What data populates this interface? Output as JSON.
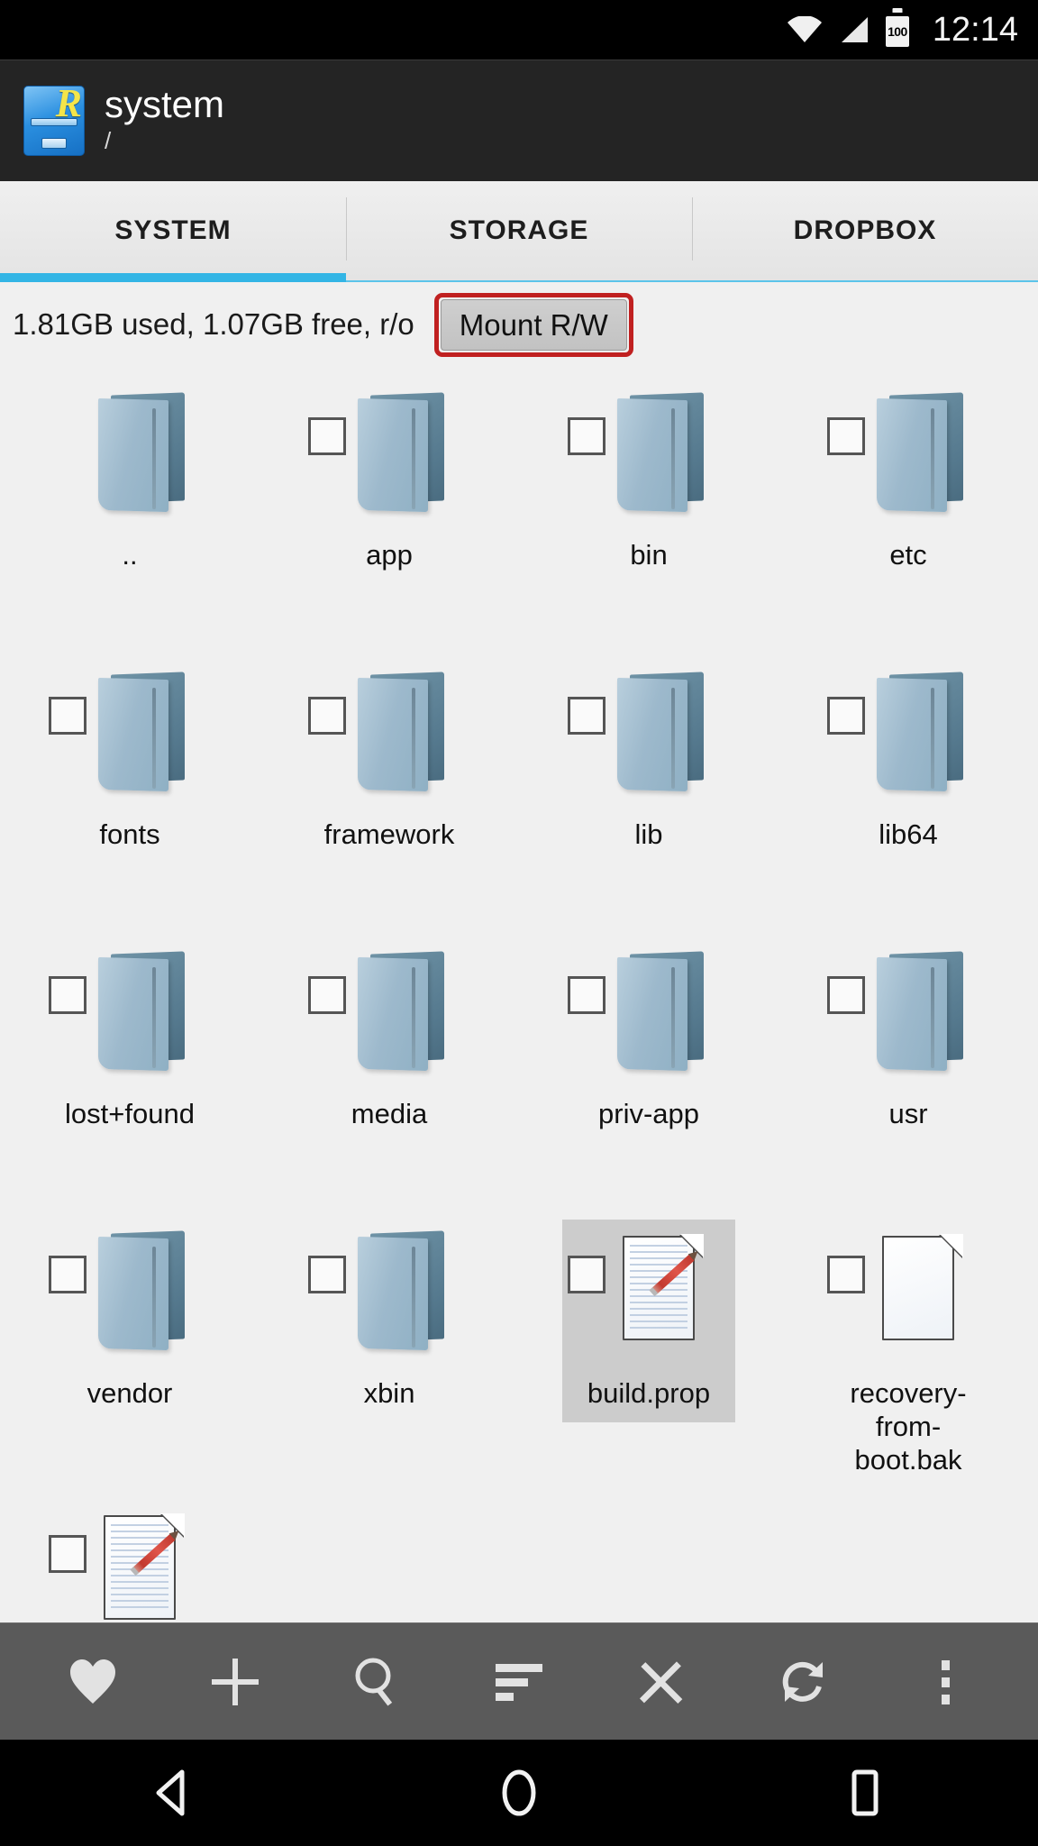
{
  "status_bar": {
    "wifi_icon": "wifi-icon",
    "signal_icon": "cell-signal-icon",
    "battery_icon": "battery-icon",
    "battery_level": "100",
    "time": "12:14"
  },
  "app_header": {
    "app_icon": "root-explorer-icon",
    "title": "system",
    "subtitle": "/"
  },
  "tabs": [
    {
      "label": "SYSTEM",
      "active": true
    },
    {
      "label": "STORAGE",
      "active": false
    },
    {
      "label": "DROPBOX",
      "active": false
    }
  ],
  "mount_bar": {
    "storage_info": "1.81GB used, 1.07GB free, r/o",
    "mount_button": "Mount R/W",
    "highlight_color": "#c02020"
  },
  "files": [
    {
      "name": "..",
      "type": "folder",
      "checkbox": false,
      "selected": false
    },
    {
      "name": "app",
      "type": "folder",
      "checkbox": true,
      "selected": false
    },
    {
      "name": "bin",
      "type": "folder",
      "checkbox": true,
      "selected": false
    },
    {
      "name": "etc",
      "type": "folder",
      "checkbox": true,
      "selected": false
    },
    {
      "name": "fonts",
      "type": "folder",
      "checkbox": true,
      "selected": false
    },
    {
      "name": "framework",
      "type": "folder",
      "checkbox": true,
      "selected": false
    },
    {
      "name": "lib",
      "type": "folder",
      "checkbox": true,
      "selected": false
    },
    {
      "name": "lib64",
      "type": "folder",
      "checkbox": true,
      "selected": false
    },
    {
      "name": "lost+found",
      "type": "folder",
      "checkbox": true,
      "selected": false
    },
    {
      "name": "media",
      "type": "folder",
      "checkbox": true,
      "selected": false
    },
    {
      "name": "priv-app",
      "type": "folder",
      "checkbox": true,
      "selected": false
    },
    {
      "name": "usr",
      "type": "folder",
      "checkbox": true,
      "selected": false
    },
    {
      "name": "vendor",
      "type": "folder",
      "checkbox": true,
      "selected": false
    },
    {
      "name": "xbin",
      "type": "folder",
      "checkbox": true,
      "selected": false
    },
    {
      "name": "build.prop",
      "type": "textfile",
      "checkbox": true,
      "selected": true
    },
    {
      "name": "recovery-from-boot.bak",
      "type": "blankfile",
      "checkbox": true,
      "selected": false
    },
    {
      "name": "",
      "type": "textfile",
      "checkbox": true,
      "selected": false
    }
  ],
  "toolbar": [
    {
      "icon": "heart-icon",
      "label": "Bookmarks"
    },
    {
      "icon": "plus-icon",
      "label": "New"
    },
    {
      "icon": "search-icon",
      "label": "Search"
    },
    {
      "icon": "sort-icon",
      "label": "Sort"
    },
    {
      "icon": "close-icon",
      "label": "Close"
    },
    {
      "icon": "refresh-icon",
      "label": "Refresh"
    },
    {
      "icon": "overflow-menu-icon",
      "label": "More options"
    }
  ],
  "nav_bar": [
    {
      "icon": "back-icon",
      "label": "Back"
    },
    {
      "icon": "home-icon",
      "label": "Home"
    },
    {
      "icon": "recents-icon",
      "label": "Recents"
    }
  ],
  "colors": {
    "accent_blue": "#33b5e5",
    "toolbar_gray": "#5a5a5a",
    "header_dark": "#242424",
    "selection_gray": "#cccccc",
    "page_bg": "#f0f0f0"
  }
}
